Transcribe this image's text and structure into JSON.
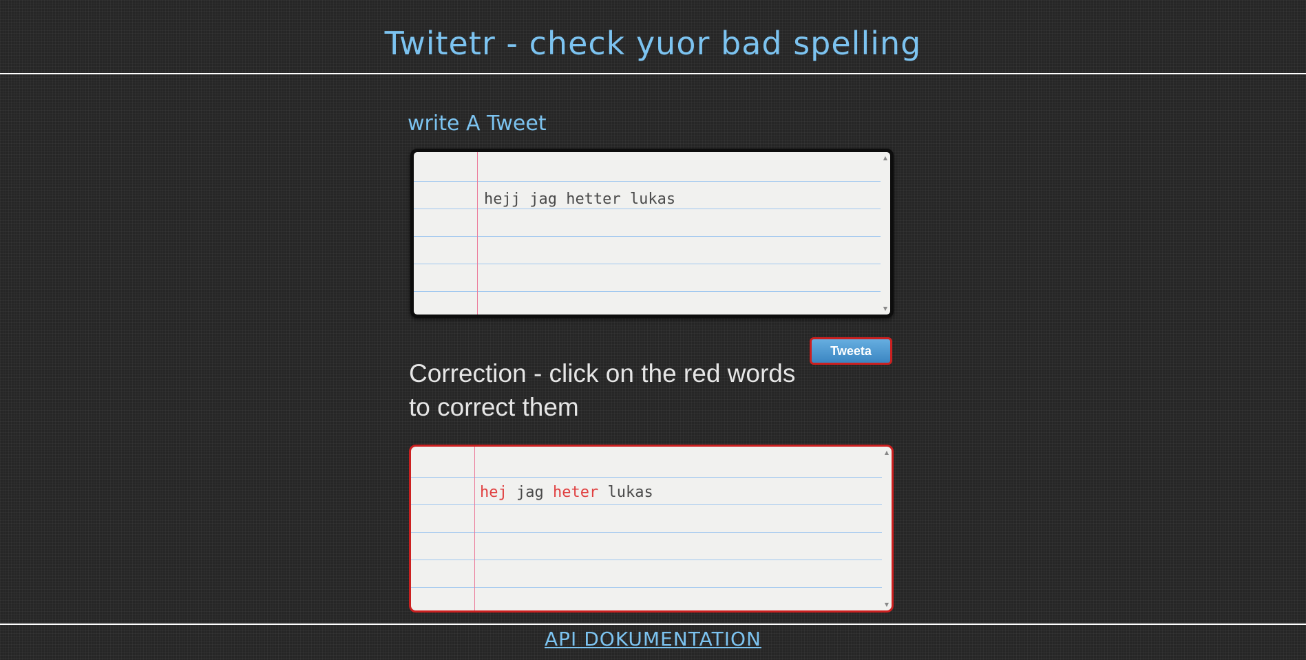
{
  "header": {
    "title": "Twitetr - check yuor bad spelling"
  },
  "compose": {
    "heading": "write A Tweet",
    "value": "hejj jag hetter lukas",
    "button_label": "Tweeta"
  },
  "correction": {
    "heading": "Correction - click on the red words to correct them",
    "words": [
      {
        "text": "hej",
        "status": "corrected"
      },
      {
        "text": "jag",
        "status": "ok"
      },
      {
        "text": "heter",
        "status": "corrected"
      },
      {
        "text": "lukas",
        "status": "ok"
      }
    ]
  },
  "footer": {
    "link_label": "API DOKUMENTATION"
  },
  "colors": {
    "accent": "#7cc3f0",
    "error": "#e04040",
    "button_border": "#cc2020",
    "button_fill": "#4b9ad3"
  }
}
